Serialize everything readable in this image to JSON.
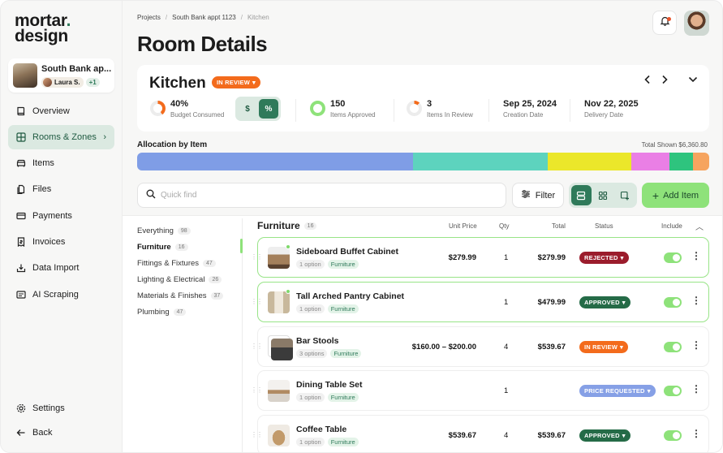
{
  "brand": {
    "line1": "mortar",
    "dot": ".",
    "line2": "design"
  },
  "project": {
    "name": "South Bank ap...",
    "user": "Laura S.",
    "extra": "+1"
  },
  "nav": [
    {
      "label": "Overview",
      "icon": "book-icon"
    },
    {
      "label": "Rooms & Zones",
      "icon": "grid-icon",
      "active": true
    },
    {
      "label": "Items",
      "icon": "sofa-icon"
    },
    {
      "label": "Files",
      "icon": "files-icon"
    },
    {
      "label": "Payments",
      "icon": "card-icon"
    },
    {
      "label": "Invoices",
      "icon": "invoice-icon"
    },
    {
      "label": "Data Import",
      "icon": "import-icon"
    },
    {
      "label": "AI Scraping",
      "icon": "scan-icon"
    }
  ],
  "footer_nav": {
    "settings": "Settings",
    "back": "Back"
  },
  "breadcrumb": {
    "projects": "Projects",
    "project": "South Bank appt 1123",
    "current": "Kitchen",
    "sep": "/"
  },
  "page_title": "Room Details",
  "room": {
    "name": "Kitchen",
    "status": "IN REVIEW",
    "budget_value": "40%",
    "budget_label": "Budget Consumed",
    "currency_toggle": {
      "dollar": "$",
      "percent": "%",
      "selected": "%"
    },
    "approved_value": "150",
    "approved_label": "Items Approved",
    "review_value": "3",
    "review_label": "Items In Review",
    "creation_value": "Sep 25, 2024",
    "creation_label": "Creation Date",
    "delivery_value": "Nov 22, 2025",
    "delivery_label": "Delivery Date"
  },
  "allocation": {
    "title": "Allocation by Item",
    "total": "Total Shown $6,360.80",
    "segments": [
      {
        "share": 0.482,
        "color": "#7f9de6"
      },
      {
        "share": 0.236,
        "color": "#5dd3be"
      },
      {
        "share": 0.146,
        "color": "#ebe72a"
      },
      {
        "share": 0.066,
        "color": "#ea7fe5"
      },
      {
        "share": 0.041,
        "color": "#2ec47e"
      },
      {
        "share": 0.029,
        "color": "#f6a45f"
      }
    ]
  },
  "toolbar": {
    "search_placeholder": "Quick find",
    "filter_label": "Filter",
    "add_label": "Add Item"
  },
  "categories": [
    {
      "label": "Everything",
      "count": "98"
    },
    {
      "label": "Furniture",
      "count": "16",
      "active": true
    },
    {
      "label": "Fittings & Fixtures",
      "count": "47"
    },
    {
      "label": "Lighting & Electrical",
      "count": "26"
    },
    {
      "label": "Materials & Finishes",
      "count": "37"
    },
    {
      "label": "Plumbing",
      "count": "47"
    }
  ],
  "table": {
    "title": "Furniture",
    "count": "16",
    "headers": {
      "unit_price": "Unit Price",
      "qty": "Qty",
      "total": "Total",
      "status": "Status",
      "include": "Include"
    },
    "rows": [
      {
        "name": "Sideboard Buffet Cabinet",
        "options": "1 option",
        "tag": "Furniture",
        "unit_price": "$279.99",
        "qty": "1",
        "total": "$279.99",
        "status": "REJECTED",
        "status_color": "#9b1c2c",
        "included": true
      },
      {
        "name": "Tall Arched Pantry Cabinet",
        "options": "1 option",
        "tag": "Furniture",
        "unit_price": "",
        "qty": "1",
        "total": "$479.99",
        "status": "APPROVED",
        "status_color": "#256b47",
        "included": true
      },
      {
        "name": "Bar Stools",
        "options": "3 options",
        "tag": "Furniture",
        "unit_price": "$160.00 – $200.00",
        "qty": "4",
        "total": "$539.67",
        "status": "IN REVIEW",
        "status_color": "#f36b1c",
        "included": true
      },
      {
        "name": "Dining Table Set",
        "options": "1 option",
        "tag": "Furniture",
        "unit_price": "",
        "qty": "1",
        "total": "",
        "status": "PRICE REQUESTED",
        "status_color": "#86a0e6",
        "included": true
      },
      {
        "name": "Coffee Table",
        "options": "1 option",
        "tag": "Furniture",
        "unit_price": "$539.67",
        "qty": "4",
        "total": "$539.67",
        "status": "APPROVED",
        "status_color": "#256b47",
        "included": true
      }
    ]
  }
}
